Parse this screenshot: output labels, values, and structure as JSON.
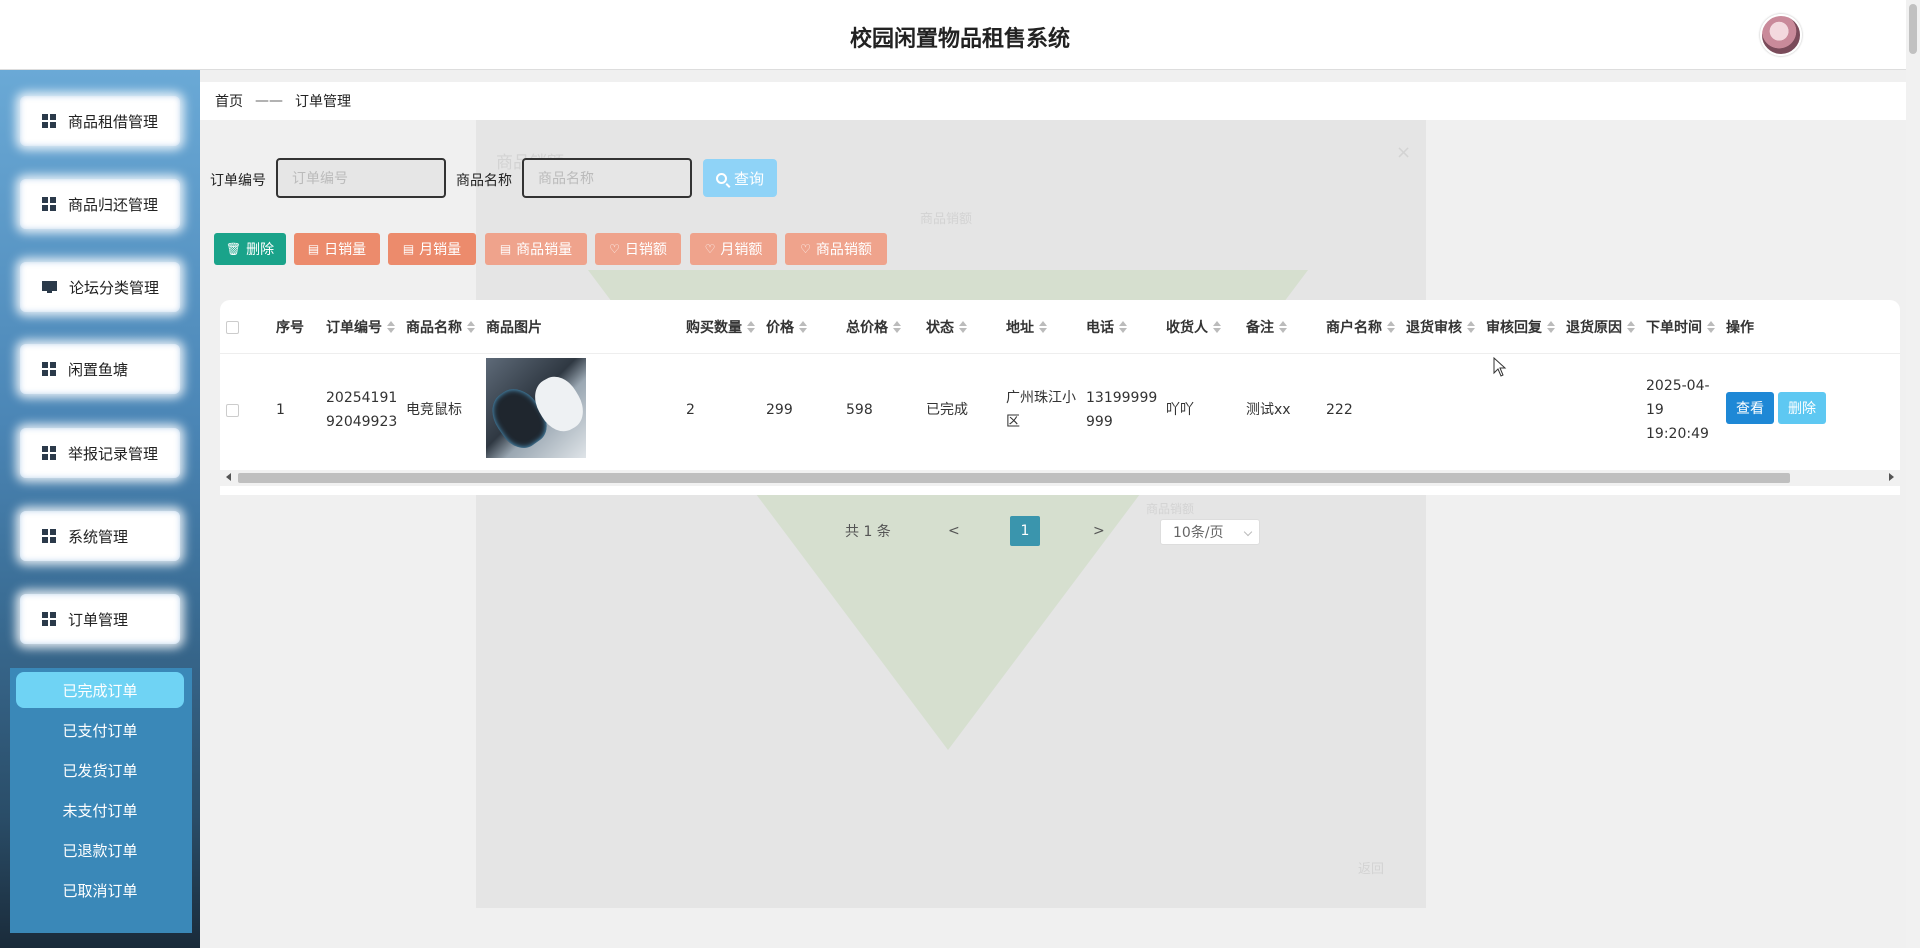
{
  "app": {
    "title": "校园闲置物品租售系统"
  },
  "sidebar": {
    "items": [
      {
        "label": "商品租借管理",
        "icon": "grid-icon"
      },
      {
        "label": "商品归还管理",
        "icon": "grid-icon"
      },
      {
        "label": "论坛分类管理",
        "icon": "monitor-icon"
      },
      {
        "label": "闲置鱼塘",
        "icon": "grid-icon"
      },
      {
        "label": "举报记录管理",
        "icon": "grid-icon"
      },
      {
        "label": "系统管理",
        "icon": "grid-icon"
      },
      {
        "label": "订单管理",
        "icon": "grid-icon"
      }
    ],
    "submenu": [
      {
        "label": "已完成订单",
        "active": true
      },
      {
        "label": "已支付订单"
      },
      {
        "label": "已发货订单"
      },
      {
        "label": "未支付订单"
      },
      {
        "label": "已退款订单"
      },
      {
        "label": "已取消订单"
      }
    ]
  },
  "breadcrumb": {
    "home": "首页",
    "separator": "——",
    "current": "订单管理"
  },
  "search": {
    "order_label": "订单编号",
    "order_placeholder": "订单编号",
    "product_label": "商品名称",
    "product_placeholder": "商品名称",
    "query_button": "查询"
  },
  "toolbar": {
    "delete": "删除",
    "daily_sales_qty": "日销量",
    "monthly_sales_qty": "月销量",
    "product_sales_qty": "商品销量",
    "daily_sales_amt": "日销额",
    "monthly_sales_amt": "月销额",
    "product_sales_amt": "商品销额"
  },
  "table": {
    "headers": [
      "序号",
      "订单编号",
      "商品名称",
      "商品图片",
      "购买数量",
      "价格",
      "总价格",
      "状态",
      "地址",
      "电话",
      "收货人",
      "备注",
      "商户名称",
      "退货审核",
      "审核回复",
      "退货原因",
      "下单时间",
      "操作"
    ],
    "rows": [
      {
        "index": "1",
        "order_no": "2025419192049923",
        "product_name": "电竞鼠标",
        "quantity": "2",
        "price": "299",
        "total": "598",
        "status": "已完成",
        "address": "广州珠江小区",
        "phone": "13199999999",
        "receiver": "吖吖",
        "note": "测试xx",
        "merchant": "222",
        "return_review": "",
        "review_reply": "",
        "return_reason": "",
        "order_time": "2025-04-19 19:20:49",
        "view_button": "查看",
        "delete_button": "删除"
      }
    ]
  },
  "pagination": {
    "total": "共 1 条",
    "prev": "<",
    "page": "1",
    "next": ">",
    "page_size": "10条/页"
  },
  "ghost_dialog": {
    "title": "商品销额",
    "subtitle": "商品销额",
    "axis_note": "商品销额",
    "close": "×",
    "back": "返回"
  },
  "colors": {
    "accent": "#1e88d6",
    "query": "#8fd3f7",
    "delete_green": "#1aa38a",
    "sales_orange": "#ec8b6c",
    "page_active": "#3a95ad"
  }
}
